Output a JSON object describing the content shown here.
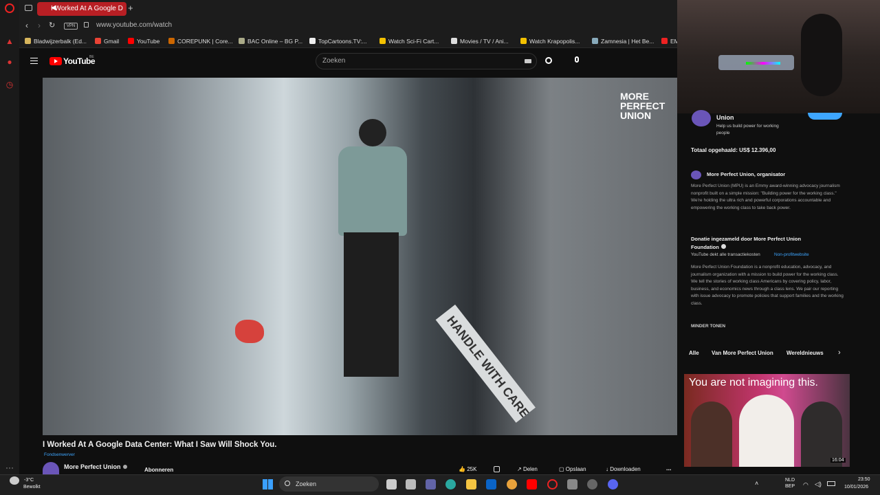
{
  "browser": {
    "tab_title": "I Worked At A Google D",
    "url": "www.youtube.com/watch",
    "vpn": "VPN",
    "bookmarks": [
      "Bladwijzerbalk (Ed...",
      "Gmail",
      "YouTube",
      "COREPUNK | Core...",
      "BAC Online – BG P...",
      "TopCartoons.TV:...",
      "Watch Sci-Fi Cart...",
      "Movies / TV / Ani...",
      "Watch Krapopolis...",
      "Zamnesia | Het Be...",
      "EM"
    ]
  },
  "youtube": {
    "logo_text": "YouTube",
    "country_code": "BE",
    "search_placeholder": "Zoeken"
  },
  "video": {
    "overlay_brand": [
      "MORE",
      "PERFECT",
      "UNION"
    ],
    "sign_text": "HANDLE WITH CARE",
    "title": "I Worked At A Google Data Center: What I Saw Will Shock You.",
    "fundraiser_label": "Fondsenwerver",
    "channel_name": "More Perfect Union",
    "subscribe_label": "Abonneren",
    "like_count": "25K",
    "share_label": "Delen",
    "save_label": "Opslaan",
    "download_label": "Downloaden",
    "more_label": "..."
  },
  "fundraiser_panel": {
    "org_name": "Union",
    "org_tagline": "Help us build power for working people",
    "total_raised": "Totaal opgehaald: US$ 12.396,00",
    "organizer": "More Perfect Union, organisator",
    "organizer_desc": "More Perfect Union (MPU) is an Emmy award-winning advocacy journalism nonprofit built on a simple mission: \"Building power for the working class.\" We're holding the ultra rich and powerful corporations accountable and empowering the working class to take back power.",
    "donation_heading": "Donatie ingezameld door More Perfect Union Foundation",
    "donation_sub": "YouTube dekt alle transactiekosten",
    "donation_link": "Non-profitwebsite",
    "foundation_desc": "More Perfect Union Foundation is a nonprofit education, advocacy, and journalism organization with a mission to build power for the working class. We tell the stories of working class Americans by covering policy, labor, business, and economics news through a class lens. We pair our reporting with issue advocacy to promote policies that support families and the working class.",
    "show_less": "MINDER TONEN"
  },
  "chips": [
    "Alle",
    "Van More Perfect Union",
    "Wereldnieuws"
  ],
  "recommended": {
    "thumb_text": "You are not imagining this.",
    "duration": "16:04"
  },
  "taskbar": {
    "weather_temp": "-3°C",
    "weather_desc": "Bewolkt",
    "search_label": "Zoeken",
    "lang": "NLD",
    "lang_sub": "BEP",
    "time": "23:50",
    "date": "10/01/2026"
  }
}
